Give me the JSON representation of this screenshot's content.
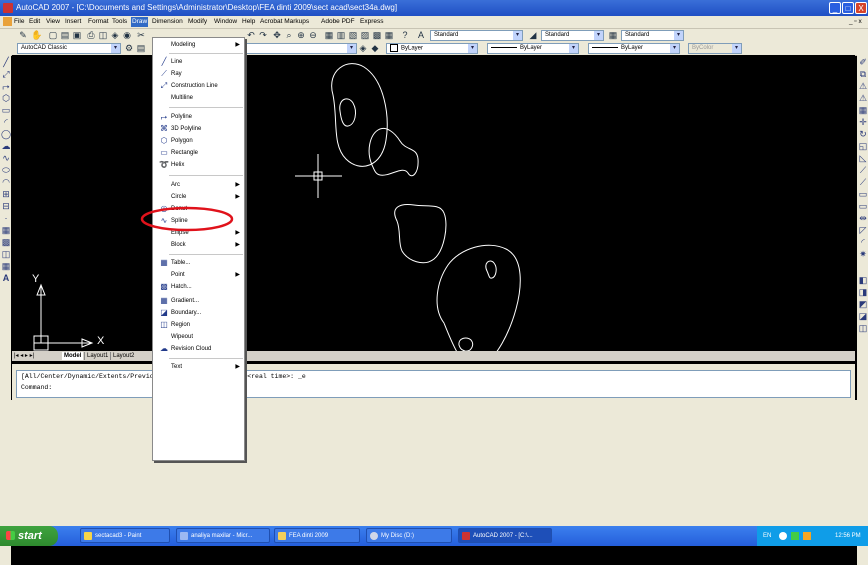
{
  "window": {
    "title": "AutoCAD 2007 - [C:\\Documents and Settings\\Administrator\\Desktop\\FEA dinti 2009\\sect acad\\sect34a.dwg]",
    "minimize_glyph": "_",
    "maximize_glyph": "□",
    "close_glyph": "X"
  },
  "menubar": {
    "items": [
      "File",
      "Edit",
      "View",
      "Insert",
      "Format",
      "Tools",
      "Draw",
      "Dimension",
      "Modify",
      "Window",
      "Help",
      "Acrobat Markups",
      "Adobe PDF",
      "Express"
    ],
    "active": "Draw",
    "doc_controls": "_ ▫ x"
  },
  "toolbars": {
    "workspace": "AutoCAD Classic",
    "text_style": "Standard",
    "dim_style": "Standard",
    "table_style": "Standard",
    "layer_color": "ByLayer",
    "linetype": "ByLayer",
    "lineweight": "ByLayer",
    "plot_style": "ByColor"
  },
  "draw_menu": {
    "items": [
      {
        "label": "Modeling",
        "icon": "",
        "submenu": true
      },
      {
        "sep": true
      },
      {
        "label": "Line",
        "icon": "line-icon"
      },
      {
        "label": "Ray",
        "icon": "ray-icon"
      },
      {
        "label": "Construction Line",
        "icon": "construction-line-icon"
      },
      {
        "label": "Multiline",
        "icon": ""
      },
      {
        "sep": true
      },
      {
        "label": "Polyline",
        "icon": "polyline-icon"
      },
      {
        "label": "3D Polyline",
        "icon": "3d-polyline-icon"
      },
      {
        "label": "Polygon",
        "icon": "polygon-icon"
      },
      {
        "label": "Rectangle",
        "icon": "rectangle-icon"
      },
      {
        "label": "Helix",
        "icon": "helix-icon"
      },
      {
        "sep": true
      },
      {
        "label": "Arc",
        "icon": "",
        "submenu": true
      },
      {
        "label": "Circle",
        "icon": "",
        "submenu": true
      },
      {
        "label": "Donut",
        "icon": "donut-icon"
      },
      {
        "label": "Spline",
        "icon": "spline-icon",
        "highlighted": true
      },
      {
        "label": "Ellipse",
        "icon": "",
        "submenu": true
      },
      {
        "label": "Block",
        "icon": "",
        "submenu": true
      },
      {
        "sep": true
      },
      {
        "label": "Table...",
        "icon": "table-icon"
      },
      {
        "label": "Point",
        "icon": "",
        "submenu": true
      },
      {
        "label": "Hatch...",
        "icon": "hatch-icon"
      },
      {
        "label": "Gradient...",
        "icon": "gradient-icon"
      },
      {
        "label": "Boundary...",
        "icon": "boundary-icon"
      },
      {
        "label": "Region",
        "icon": "region-icon"
      },
      {
        "label": "Wipeout",
        "icon": ""
      },
      {
        "label": "Revision Cloud",
        "icon": "revision-cloud-icon"
      },
      {
        "sep": true
      },
      {
        "label": "Text",
        "icon": "",
        "submenu": true
      }
    ],
    "highlight_color": "#e0121b"
  },
  "drawing": {
    "ucs_y": "Y",
    "ucs_x": "X",
    "background": "#000000",
    "line_color": "#ffffff"
  },
  "layout_tabs": {
    "nav": "|◂ ◂ ▸ ▸|",
    "tabs": [
      "Model",
      "Layout1",
      "Layout2"
    ],
    "active": "Model"
  },
  "command": {
    "history": "[All/Center/Dynamic/Extents/Previous/Scale/Window/Object] <real time>: _e",
    "prompt": "Command:"
  },
  "taskbar": {
    "start": "start",
    "buttons": [
      {
        "label": "sectacad3 - Paint",
        "active": false
      },
      {
        "label": "analiya maxilar - Micr...",
        "active": false
      },
      {
        "label": "FEA dinti 2009",
        "active": false
      },
      {
        "label": "My Disc (D:)",
        "active": false
      },
      {
        "label": "AutoCAD 2007 - [C:\\...",
        "active": true
      }
    ],
    "tray_lang": "EN",
    "clock": "12:56 PM"
  }
}
